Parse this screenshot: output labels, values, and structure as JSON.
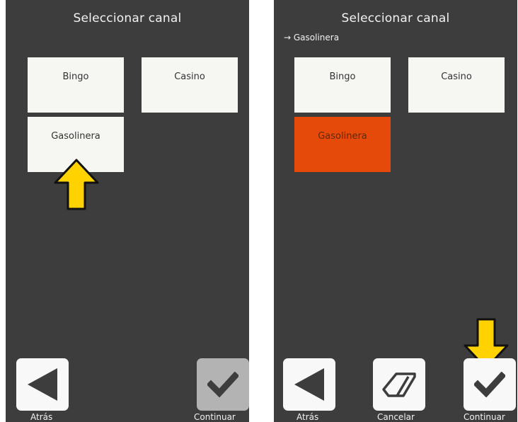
{
  "left": {
    "title": "Seleccionar canal",
    "tiles": [
      "Bingo",
      "Casino",
      "Gasolinera"
    ],
    "buttons": {
      "back": "Atrás",
      "continue": "Continuar"
    }
  },
  "right": {
    "title": "Seleccionar canal",
    "breadcrumb": "→ Gasolinera",
    "tiles": [
      "Bingo",
      "Casino",
      "Gasolinera"
    ],
    "selected_tile": "Gasolinera",
    "buttons": {
      "back": "Atrás",
      "cancel": "Cancelar",
      "continue": "Continuar"
    }
  },
  "colors": {
    "background": "#3d3d3d",
    "tile": "#f6f7f3",
    "selected": "#e64a0a",
    "highlight_arrow": "#ffd200",
    "disabled_button": "#b3b3b3"
  },
  "icons": [
    "triangle-left-back-icon",
    "checkmark-icon",
    "eraser-icon",
    "pointer-arrow-icon"
  ]
}
